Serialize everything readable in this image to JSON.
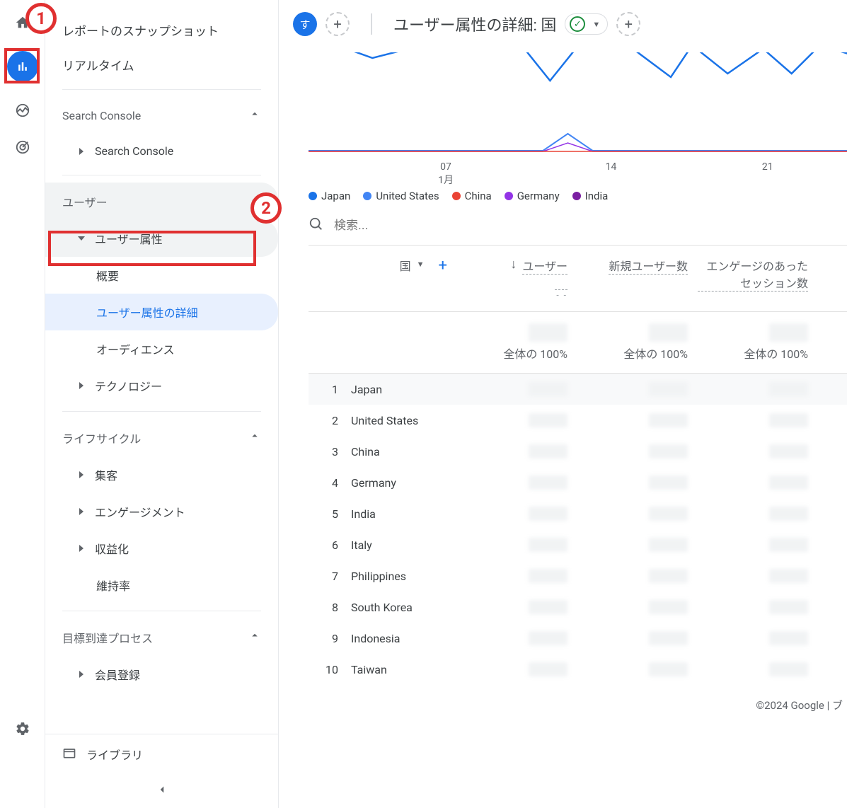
{
  "annotations": {
    "one": "1",
    "two": "2"
  },
  "sidebar": {
    "snapshot": "レポートのスナップショット",
    "realtime": "リアルタイム",
    "search_console_section": "Search Console",
    "search_console_item": "Search Console",
    "user_section": "ユーザー",
    "user_attr": "ユーザー属性",
    "overview": "概要",
    "user_attr_detail": "ユーザー属性の詳細",
    "audience": "オーディエンス",
    "technology": "テクノロジー",
    "lifecycle_section": "ライフサイクル",
    "acquisition": "集客",
    "engagement": "エンゲージメント",
    "monetization": "収益化",
    "retention": "維持率",
    "funnel_section": "目標到達プロセス",
    "signup": "会員登録",
    "library": "ライブラリ"
  },
  "topbar": {
    "badge": "す",
    "title": "ユーザー属性の詳細: 国"
  },
  "chart_data": {
    "type": "line",
    "x_ticks": [
      "07",
      "14",
      "21"
    ],
    "x_sub": "1月",
    "series": [
      {
        "name": "Japan",
        "color": "#1a73e8"
      },
      {
        "name": "United States",
        "color": "#4285f4"
      },
      {
        "name": "China",
        "color": "#ea4335"
      },
      {
        "name": "Germany",
        "color": "#9334e6"
      },
      {
        "name": "India",
        "color": "#7b1fa2"
      }
    ]
  },
  "search": {
    "placeholder": "検索..."
  },
  "table": {
    "dim_label": "国",
    "col_users": "ユーザー",
    "col_new_users": "新規ユーザー数",
    "col_engaged": "エンゲージのあったセッション数",
    "total_label": "全体の 100%",
    "rows": [
      {
        "idx": "1",
        "country": "Japan"
      },
      {
        "idx": "2",
        "country": "United States"
      },
      {
        "idx": "3",
        "country": "China"
      },
      {
        "idx": "4",
        "country": "Germany"
      },
      {
        "idx": "5",
        "country": "India"
      },
      {
        "idx": "6",
        "country": "Italy"
      },
      {
        "idx": "7",
        "country": "Philippines"
      },
      {
        "idx": "8",
        "country": "South Korea"
      },
      {
        "idx": "9",
        "country": "Indonesia"
      },
      {
        "idx": "10",
        "country": "Taiwan"
      }
    ]
  },
  "footer": "©2024 Google | ブ"
}
